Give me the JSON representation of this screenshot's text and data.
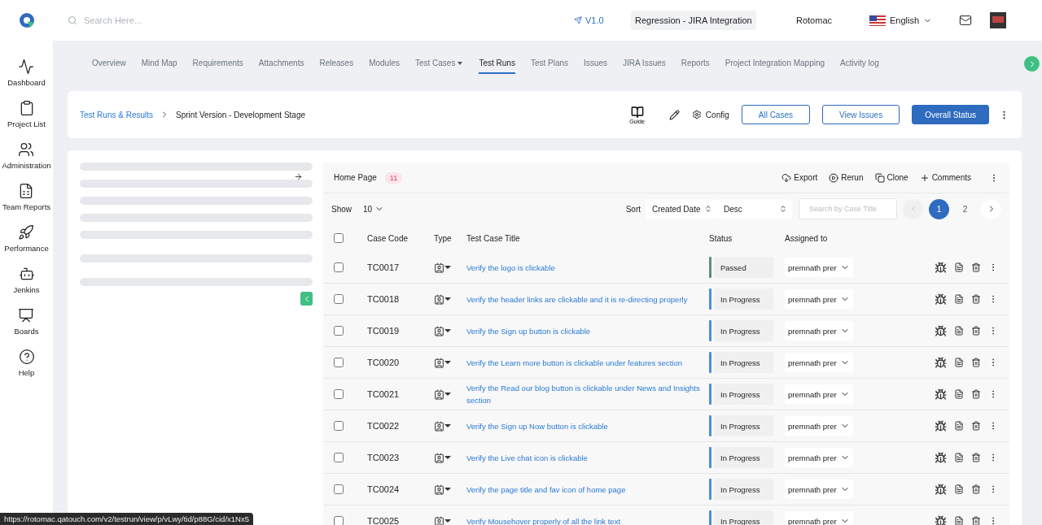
{
  "top_bar": {
    "search": {
      "placeholder": "Search Here..."
    },
    "version": "V1.0",
    "project_select": {
      "value": "Regression - JIRA Integration"
    },
    "user": "Rotomac",
    "language": "English"
  },
  "sidebar": {
    "items": [
      {
        "label": "Dashboard",
        "kind": "dashboard"
      },
      {
        "label": "Project List",
        "kind": "projects"
      },
      {
        "label": "Administration",
        "kind": "admin"
      },
      {
        "label": "Team Reports",
        "kind": "reports"
      },
      {
        "label": "Performance",
        "kind": "performance"
      },
      {
        "label": "Jenkins",
        "kind": "jenkins"
      },
      {
        "label": "Boards",
        "kind": "boards"
      },
      {
        "label": "Help",
        "kind": "help"
      }
    ]
  },
  "nav_tabs": [
    {
      "label": "Overview",
      "selected": false,
      "has_menu": false
    },
    {
      "label": "Mind Map",
      "selected": false,
      "has_menu": false
    },
    {
      "label": "Requirements",
      "selected": false,
      "has_menu": false
    },
    {
      "label": "Attachments",
      "selected": false,
      "has_menu": false
    },
    {
      "label": "Releases",
      "selected": false,
      "has_menu": false
    },
    {
      "label": "Modules",
      "selected": false,
      "has_menu": false
    },
    {
      "label": "Test Cases",
      "selected": false,
      "has_menu": true
    },
    {
      "label": "Test Runs",
      "selected": true,
      "has_menu": false
    },
    {
      "label": "Test Plans",
      "selected": false,
      "has_menu": false
    },
    {
      "label": "Issues",
      "selected": false,
      "has_menu": false
    },
    {
      "label": "JIRA Issues",
      "selected": false,
      "has_menu": false
    },
    {
      "label": "Reports",
      "selected": false,
      "has_menu": false
    },
    {
      "label": "Project Integration Mapping",
      "selected": false,
      "has_menu": false
    },
    {
      "label": "Activity log",
      "selected": false,
      "has_menu": false
    }
  ],
  "breadcrumb": [
    "Test Runs & Results",
    "Sprint Version - Development Stage"
  ],
  "toolbar": {
    "guide": "Guide",
    "config": "Config",
    "buttons": [
      {
        "label": "All Cases",
        "kind": "outline"
      },
      {
        "label": "View Issues",
        "kind": "outline"
      },
      {
        "label": "Overall Status",
        "kind": "primary"
      }
    ]
  },
  "suite": {
    "title": "Home Page",
    "count": "11",
    "actions": [
      {
        "label": "Export",
        "kind": "export"
      },
      {
        "label": "Rerun",
        "kind": "rerun"
      },
      {
        "label": "Clone",
        "kind": "clone"
      },
      {
        "label": "Comments",
        "kind": "comments"
      }
    ]
  },
  "list_controls": {
    "show_label": "Show",
    "page_size": "10",
    "sort_label": "Sort",
    "sort_field": "Created Date",
    "sort_order": "Desc",
    "search": {
      "placeholder": "Search by Case Title"
    },
    "pages": [
      {
        "label": "1",
        "selected": true
      },
      {
        "label": "2",
        "selected": false
      }
    ]
  },
  "table": {
    "select_all": {
      "checked": false
    },
    "columns": [
      "Case Code",
      "Type",
      "Test Case Title",
      "Status",
      "Assigned to"
    ],
    "rows": [
      {
        "checked": false,
        "code": "TC0017",
        "title": "Verify the logo is clickable",
        "status": "Passed",
        "color": "#5f8f7a",
        "assignee": "premnath prer"
      },
      {
        "checked": false,
        "code": "TC0018",
        "title": "Verify the header links are clickable and it is re-directing properly",
        "status": "In Progress",
        "color": "#4a90e2",
        "assignee": "premnath prer"
      },
      {
        "checked": false,
        "code": "TC0019",
        "title": "Verify the Sign up button is clickable",
        "status": "In Progress",
        "color": "#4a90e2",
        "assignee": "premnath prer"
      },
      {
        "checked": false,
        "code": "TC0020",
        "title": "Verify the Learn more button is clickable under features section",
        "status": "In Progress",
        "color": "#4a90e2",
        "assignee": "premnath prer"
      },
      {
        "checked": false,
        "code": "TC0021",
        "title": "Verify the Read our blog button is clickable under News and Insights section",
        "status": "In Progress",
        "color": "#4a90e2",
        "assignee": "premnath prer"
      },
      {
        "checked": false,
        "code": "TC0022",
        "title": "Verify the Sign up Now button is clickable",
        "status": "In Progress",
        "color": "#4a90e2",
        "assignee": "premnath prer"
      },
      {
        "checked": false,
        "code": "TC0023",
        "title": "Verify the Live chat icon is clickable",
        "status": "In Progress",
        "color": "#4a90e2",
        "assignee": "premnath prer"
      },
      {
        "checked": false,
        "code": "TC0024",
        "title": "Verify the page title and fav icon of home page",
        "status": "In Progress",
        "color": "#4a90e2",
        "assignee": "premnath prer"
      },
      {
        "checked": false,
        "code": "TC0025",
        "title": "Verify Mousehover properly of all the link text",
        "status": "In Progress",
        "color": "#4a90e2",
        "assignee": "premnath prer"
      }
    ]
  },
  "status_bar": {
    "url": "https://rotomac.qatouch.com/v2/testrun/view/p/vLwy/tid/p88G/cid/x1Nx5"
  }
}
